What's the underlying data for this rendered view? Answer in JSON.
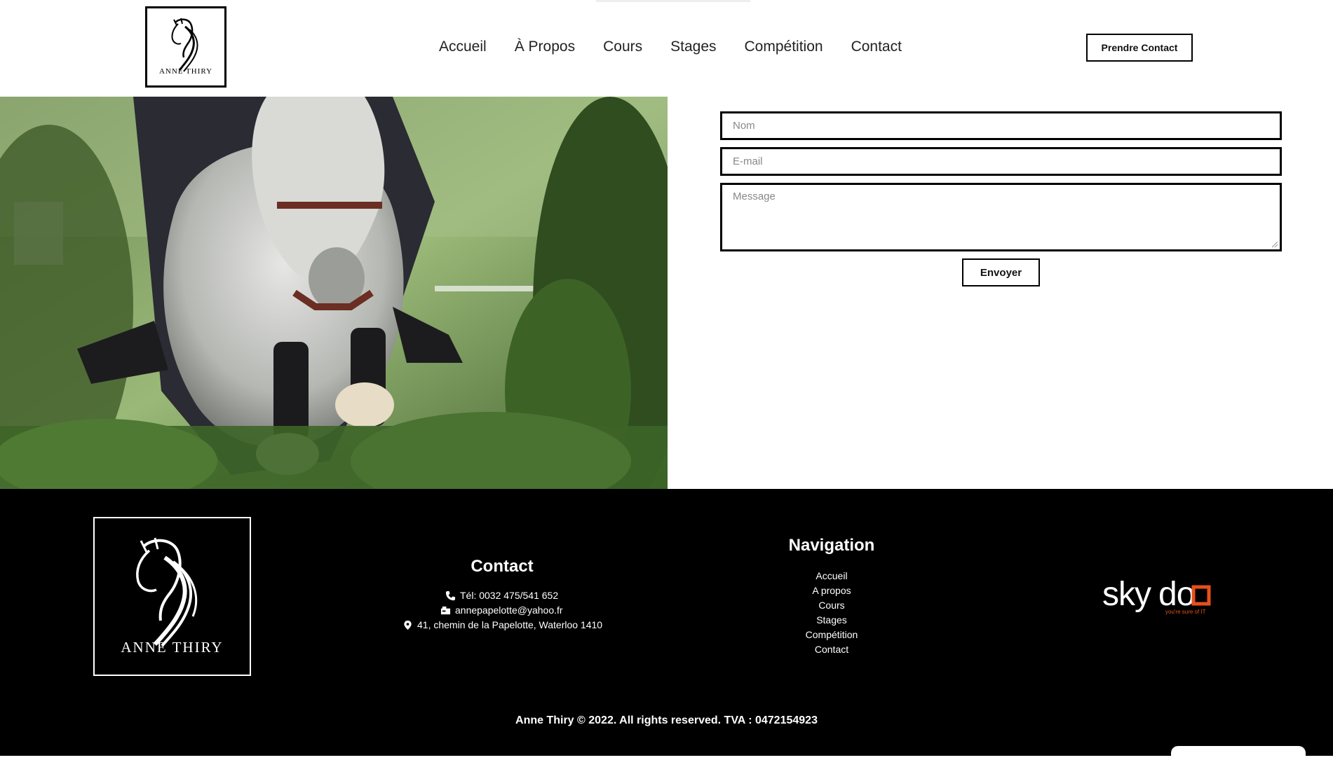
{
  "header": {
    "logo_text": "ANNE THIRY",
    "nav": [
      "Accueil",
      "À Propos",
      "Cours",
      "Stages",
      "Compétition",
      "Contact"
    ],
    "cta_label": "Prendre Contact"
  },
  "form": {
    "name_placeholder": "Nom",
    "email_placeholder": "E-mail",
    "message_placeholder": "Message",
    "send_label": "Envoyer"
  },
  "footer": {
    "logo_text": "ANNE THIRY",
    "contact": {
      "title": "Contact",
      "phone": "Tél: 0032 475/541 652",
      "email": "annepapelotte@yahoo.fr",
      "address": "41, chemin de la Papelotte, Waterloo 1410"
    },
    "navigation": {
      "title": "Navigation",
      "items": [
        "Accueil",
        "A propos",
        "Cours",
        "Stages",
        "Compétition",
        "Contact"
      ]
    },
    "partner": {
      "brand": "skydoo",
      "tagline": "you're sure of IT"
    },
    "copyright": "Anne Thiry © 2022. All rights reserved. TVA : 0472154923"
  },
  "colors": {
    "accent": "#000000",
    "partner_orange": "#e8501a"
  }
}
